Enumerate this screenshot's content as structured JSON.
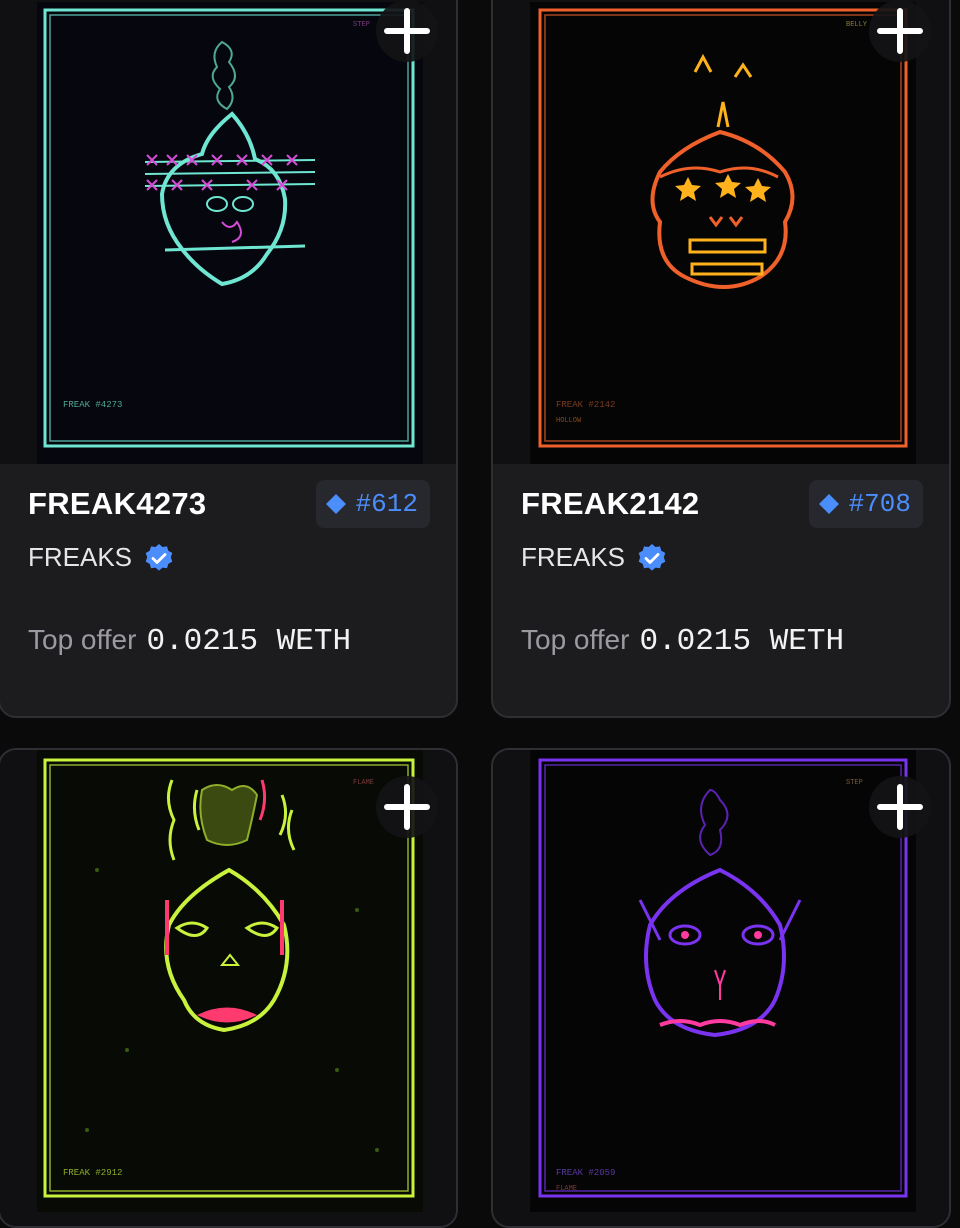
{
  "cards": [
    {
      "name": "FREAK4273",
      "rank": "#612",
      "collection": "FREAKS",
      "offer_label": "Top offer",
      "offer_value": "0.0215 WETH",
      "art": {
        "color": "#6fe6d2",
        "accent": "#d64bd6",
        "caption": "FREAK #4273",
        "corner": "STEP"
      }
    },
    {
      "name": "FREAK2142",
      "rank": "#708",
      "collection": "FREAKS",
      "offer_label": "Top offer",
      "offer_value": "0.0215 WETH",
      "art": {
        "color": "#f0602a",
        "accent": "#ffb21c",
        "caption": "FREAK #2142",
        "sub": "HOLLOW",
        "corner": "BELLY"
      }
    },
    {
      "art": {
        "color": "#c8f23c",
        "accent": "#ff3a6e",
        "caption": "FREAK #2912",
        "corner": "FLAME"
      }
    },
    {
      "art": {
        "color": "#7a33f0",
        "accent": "#ff3aa0",
        "caption": "FREAK #2059",
        "sub": "FLAME",
        "corner": "STEP"
      }
    }
  ],
  "colors": {
    "verified": "#4c8dfc",
    "rank_text": "#4c8dfc",
    "card_bg": "#1c1c1f"
  },
  "icons": [
    "plus-icon",
    "diamond-icon",
    "verified-badge-icon"
  ]
}
